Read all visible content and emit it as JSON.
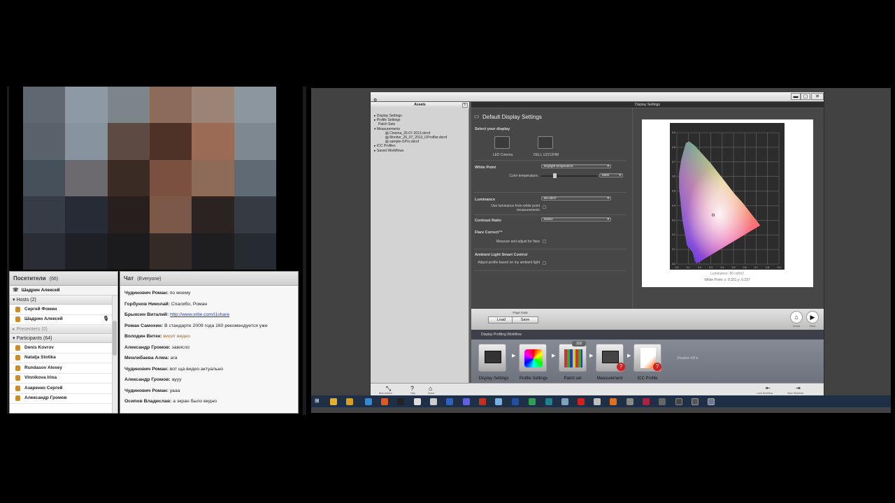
{
  "attendees": {
    "title": "Посетители",
    "count": "(66)",
    "me": "Шадрин Алексей",
    "hosts_label": "Hosts (2)",
    "hosts": [
      "Сергей Фомин",
      "Шадрин Алексей"
    ],
    "presenters_label": "Presenters (0)",
    "participants_label": "Participants (64)",
    "participants": [
      "Denis Kovrov",
      "Natalja Stotika",
      "Rundasov Alexey",
      "Vinnikova Irina",
      "Азаренко Сергей",
      "Александр Громов"
    ]
  },
  "chat": {
    "title": "Чат",
    "scope": "(Everyone)",
    "messages": [
      {
        "author": "Чудинович Роман:",
        "text": "по моему",
        "style": "plain"
      },
      {
        "author": "Горбунов Николай:",
        "text": "Спасибо, Роман",
        "style": "plain"
      },
      {
        "author": "Брыксин Виталий:",
        "text": "http://www.xrite.com/i1share",
        "style": "link"
      },
      {
        "author": "Роман Самохин:",
        "text": "В стандарте 2009 года 160 рекомендуется уже",
        "style": "plain"
      },
      {
        "author": "Володин Витек:",
        "text": "висит видео",
        "style": "orange"
      },
      {
        "author": "Александр Громов:",
        "text": "зависло",
        "style": "plain"
      },
      {
        "author": "Менлибаева Алма:",
        "text": "ага",
        "style": "plain"
      },
      {
        "author": "Чудинович Роман:",
        "text": "вот ща видео актуально",
        "style": "plain"
      },
      {
        "author": "Александр Громов:",
        "text": "ауyy",
        "style": "plain"
      },
      {
        "author": "Чудинович Роман:",
        "text": "уааа",
        "style": "plain"
      },
      {
        "author": "Осипов Владислав:",
        "text": "а экран было видно",
        "style": "plain"
      }
    ]
  },
  "app": {
    "window_title": "Display Settings",
    "assets_title": "Assets",
    "tree": [
      "Display Settings",
      "Profile Settings",
      "Patch Sets",
      "Measurements",
      "Cinema_26-07-2013.dxrof",
      "Monitor_26_07_2013_i1Profiler.dxrof",
      "sample-i1Pro.dxrof",
      "ICC Profiles",
      "Saved Workflows"
    ],
    "panel_title": "Default Display Settings",
    "select_display": "Select your display",
    "displays": [
      "LED Cinema",
      "DELL U2212HM"
    ],
    "white_point": "White Point",
    "white_point_value": "Daylight temperature",
    "color_temperature_label": "Color temperature:",
    "color_temperature_value": "6500",
    "luminance": "Luminance",
    "luminance_value": "80 cd/m²",
    "use_luminance": "Use luminance from white point measurements",
    "contrast_ratio": "Contrast Ratio",
    "contrast_value": "Native",
    "flare_correct": "Flare Correct™",
    "measure_flare": "Measure and adjust for flare",
    "ambient": "Ambient Light Smart Control",
    "adjust_ambient": "Adjust profile based on my ambient light",
    "plot_luminance": "Luminance: 80 cd/m2",
    "white_point_readout": "White Point:   x: 0.321   y: 0.337",
    "page_data_label": "Page Data",
    "load_label": "Load",
    "save_label": "Save",
    "home_label": "Home",
    "next_label": "Next",
    "workflow_title": "Display Profiling Workflow",
    "steps": [
      "Display Settings",
      "Profile Settings",
      "Patch set",
      "Measurement",
      "ICC Profile"
    ],
    "patch_badge": "118",
    "shift_label": "Shadow Off",
    "footer": [
      "Bulk Actions",
      "Help",
      "Home",
      "Load Workflow",
      "Save Workflow"
    ]
  },
  "chart_data": {
    "type": "scatter",
    "title": "",
    "xlabel": "",
    "ylabel": "",
    "xlim": [
      0,
      0.9
    ],
    "ylim": [
      0,
      0.9
    ],
    "x_ticks": [
      "0.0",
      "0.1",
      "0.2",
      "0.3",
      "0.4",
      "0.5",
      "0.6",
      "0.7",
      "0.8",
      "0.9"
    ],
    "y_ticks": [
      "0.0",
      "0.1",
      "0.2",
      "0.3",
      "0.4",
      "0.5",
      "0.6",
      "0.7",
      "0.8",
      "0.9"
    ],
    "series": [
      {
        "x": [
          0.321
        ],
        "y": [
          0.337
        ]
      }
    ],
    "grid": true
  }
}
